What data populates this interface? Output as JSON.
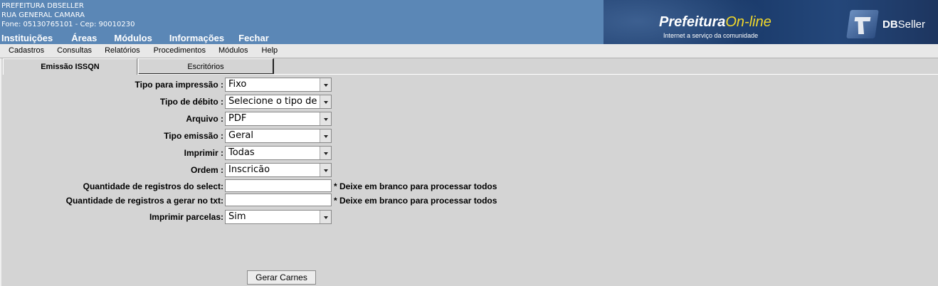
{
  "header": {
    "org_name": "PREFEITURA DBSELLER",
    "address": "RUA GENERAL CAMARA",
    "contact": "Fone: 05130765101  -  Cep: 90010230",
    "nav": [
      "Instituições",
      "Áreas",
      "Módulos",
      "Informações",
      "Fechar"
    ],
    "banner": {
      "prefeitura": "Prefeitura",
      "online": "On-line",
      "tagline": "Internet a serviço da comunidade",
      "db_bold": "DB",
      "db_regular": "Seller"
    }
  },
  "menubar": [
    "Cadastros",
    "Consultas",
    "Relatórios",
    "Procedimentos",
    "Módulos",
    "Help"
  ],
  "tabs": [
    {
      "label": "Emissão ISSQN",
      "active": true
    },
    {
      "label": "Escritórios",
      "active": false
    }
  ],
  "form": {
    "tipo_impressao": {
      "label": "Tipo para impressão :",
      "value": "Fixo"
    },
    "tipo_debito": {
      "label": "Tipo de débito :",
      "value": "Selecione o tipo de"
    },
    "arquivo": {
      "label": "Arquivo :",
      "value": "PDF"
    },
    "tipo_emissao": {
      "label": "Tipo emissão :",
      "value": "Geral"
    },
    "imprimir": {
      "label": "Imprimir :",
      "value": "Todas"
    },
    "ordem": {
      "label": "Ordem :",
      "value": "Inscricão"
    },
    "qtd_select": {
      "label": "Quantidade de registros do select:",
      "value": "",
      "hint": "* Deixe em branco para processar todos"
    },
    "qtd_txt": {
      "label": "Quantidade de registros a gerar no txt:",
      "value": "",
      "hint": "* Deixe em branco para processar todos"
    },
    "imprimir_parcelas": {
      "label": "Imprimir parcelas:",
      "value": "Sim"
    },
    "submit_label": "Gerar Carnes"
  },
  "colors": {
    "header_bg": "#5b87b6",
    "page_bg": "#d4d4d4",
    "banner_bg": "#1e3e6e",
    "online_yellow": "#f3d92a"
  },
  "icons": {
    "banner_logo": "dbseller-logo",
    "select_arrow": "chevron-down-icon"
  }
}
